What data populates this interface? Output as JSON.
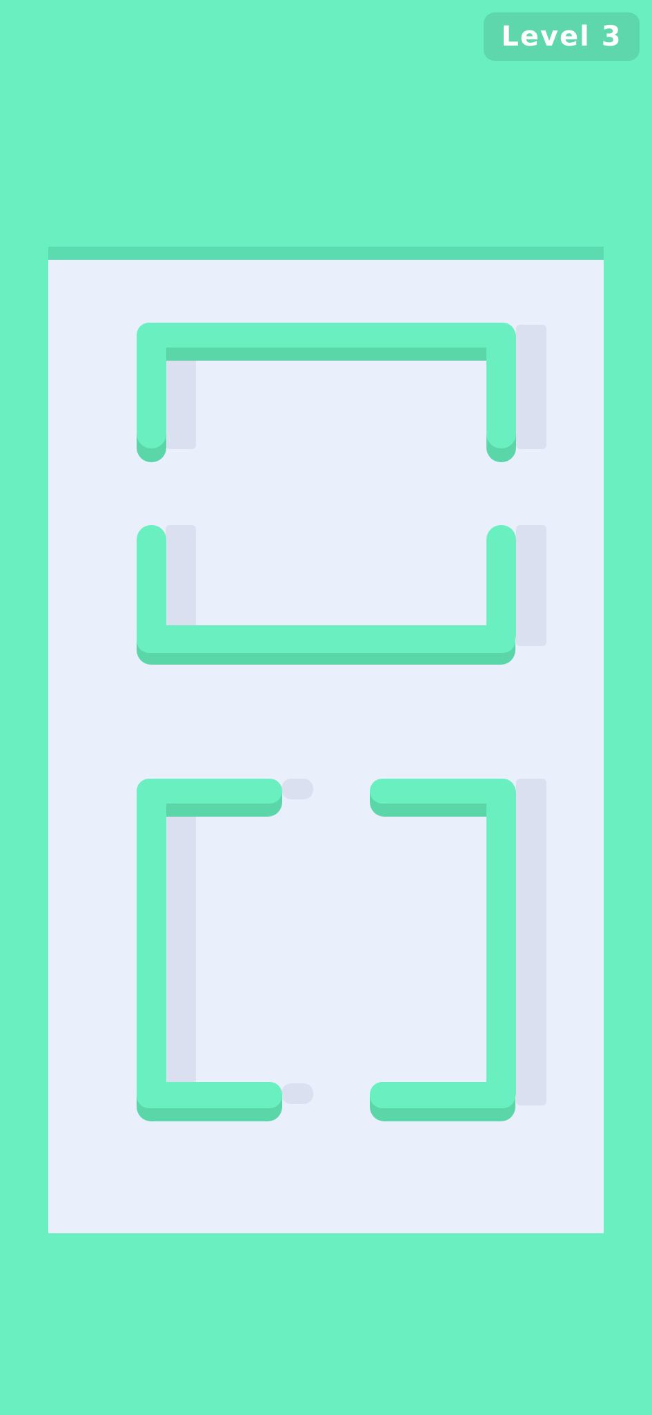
{
  "hud": {
    "level_label": "Level 3"
  },
  "colors": {
    "background": "#6af0c0",
    "board": "#eaeffc",
    "board_top_edge": "#5ddbb0",
    "pipe_top": "#6af0c0",
    "pipe_side": "#5ad6a8",
    "pipe_cap": "#5fe6b6",
    "shadow": "#dbe0f0",
    "badge": "#5dd7ab"
  },
  "pieces": [
    {
      "name": "top-bracket-piece",
      "shape": "inverted-u"
    },
    {
      "name": "middle-bracket-piece",
      "shape": "u"
    },
    {
      "name": "left-bracket-piece",
      "shape": "left-bracket"
    },
    {
      "name": "right-bracket-piece",
      "shape": "right-bracket"
    }
  ]
}
